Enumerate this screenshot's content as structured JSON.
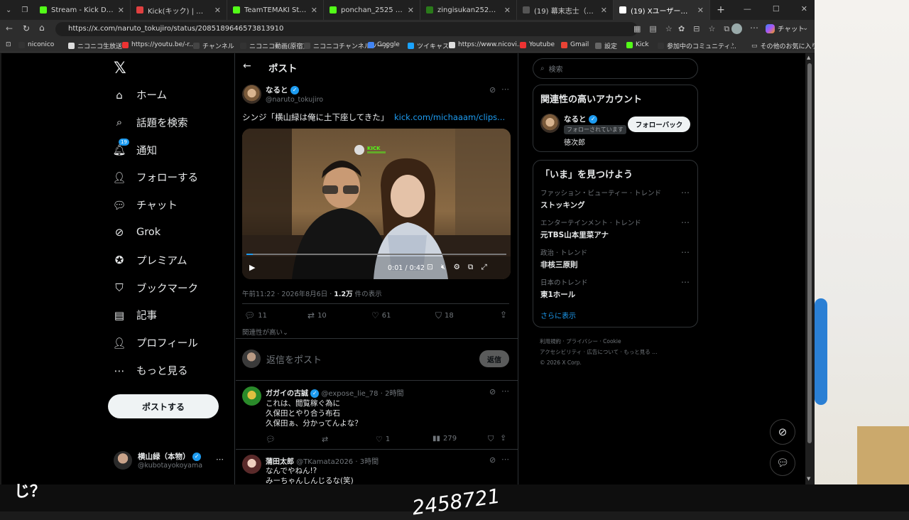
{
  "browser": {
    "tabs": [
      {
        "label": "Stream - Kick Dashboard",
        "color": "#53fc18"
      },
      {
        "label": "Kick(キック) | リアルタイムランキ",
        "color": "#e04040"
      },
      {
        "label": "TeamTEMAKI Stream - Wat",
        "color": "#53fc18"
      },
      {
        "label": "ponchan_2525 Stream - Wa",
        "color": "#53fc18"
      },
      {
        "label": "zingisukan2525 Stream - W",
        "color": "#2a7a1a"
      },
      {
        "label": "(19) 幕末志士（@kirizaki_e",
        "color": "#555555"
      },
      {
        "label": "(19) Xユーザーのなるとさん「シ",
        "color": "#ffffff"
      }
    ],
    "url": "https://x.com/naruto_tokujiro/status/2085189646573813910",
    "chat_label": "チャット",
    "bookmarks": [
      "niconico",
      "ニコニコ生放送",
      "https://youtu.be/-r...",
      "チャンネル",
      "ニコニコ動画(原宿)",
      "ニコニコチャンネルツール",
      "Google",
      "ツイキャス",
      "https://www.nicovi...",
      "Youtube",
      "Gmail",
      "設定",
      "Kick",
      "参加中のコミュニティ..."
    ],
    "other_bookmarks": "その他のお気に入り"
  },
  "sidebar": {
    "items": [
      {
        "label": "ホーム",
        "icon": "home-icon"
      },
      {
        "label": "話題を検索",
        "icon": "search-icon"
      },
      {
        "label": "通知",
        "icon": "bell-icon",
        "badge": "19"
      },
      {
        "label": "フォローする",
        "icon": "follow-icon"
      },
      {
        "label": "チャット",
        "icon": "chat-icon"
      },
      {
        "label": "Grok",
        "icon": "grok-icon"
      },
      {
        "label": "プレミアム",
        "icon": "premium-icon"
      },
      {
        "label": "ブックマーク",
        "icon": "bookmark-icon"
      },
      {
        "label": "記事",
        "icon": "article-icon"
      },
      {
        "label": "プロフィール",
        "icon": "profile-icon"
      },
      {
        "label": "もっと見る",
        "icon": "more-icon"
      }
    ],
    "post_button": "ポストする",
    "account": {
      "name": "横山緑（本物）",
      "handle": "@kubotayokoyama"
    }
  },
  "header": {
    "title": "ポスト"
  },
  "post": {
    "author": "なると",
    "handle": "@naruto_tokujiro",
    "text": "シンジ「横山緑は俺に土下座してきた」",
    "link": "kick.com/michaaam/clips...",
    "video_time": "0:01 / 0:42",
    "video_overlay": "KICK",
    "timestamp": "午前11:22 · 2026年8月6日 · ",
    "views_count": "1.2万",
    "views_label": " 件の表示",
    "replies": "11",
    "reposts": "10",
    "likes": "61",
    "bookmarks": "18",
    "sort_label": "関連性が高い"
  },
  "reply_box": {
    "placeholder": "返信をポスト",
    "button": "返信"
  },
  "replies": [
    {
      "name": "ガガイの古誠",
      "handle": "@expose_lie_78",
      "time": "2時間",
      "lines": [
        "これは、閲覧稼ぐ為に",
        "久保田とやり合う布石",
        "久保田ぁ、分かってんよな？"
      ],
      "likes": "1",
      "views": "279"
    },
    {
      "name": "蒲田太郎",
      "handle": "@TKamata2026",
      "time": "3時間",
      "lines": [
        "なんでやねん!?",
        "みーちゃんしんじるな(笑)"
      ]
    }
  ],
  "right": {
    "search_placeholder": "検索",
    "related_title": "関連性の高いアカウント",
    "related": {
      "name": "なると",
      "sub": "フォローされています",
      "name2": "徳次郎",
      "button": "フォローバック"
    },
    "trends_title": "「いま」を見つけよう",
    "trends": [
      {
        "cat": "ファッション・ビューティー · トレンド",
        "name": "ストッキング"
      },
      {
        "cat": "エンターテインメント · トレンド",
        "name": "元TBS山本里菜アナ"
      },
      {
        "cat": "政治 · トレンド",
        "name": "非核三原則"
      },
      {
        "cat": "日本のトレンド",
        "name": "東1ホール"
      }
    ],
    "show_more": "さらに表示",
    "footer": [
      "利用規約",
      "プライバシー",
      "Cookie",
      "アクセシビリティ",
      "広告について",
      "もっと見る …",
      "© 2026 X Corp."
    ]
  },
  "overlay": {
    "bottom_left": "じ？",
    "bottom_center": "2458721"
  }
}
